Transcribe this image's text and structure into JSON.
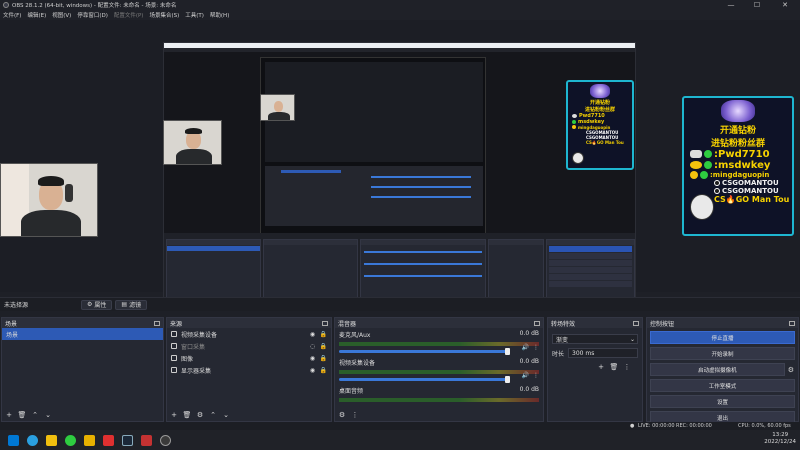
{
  "window": {
    "title": "OBS 28.1.2 (64-bit, windows) - 配置文件: 未命名 - 场景: 未命名",
    "controls": [
      "—",
      "☐",
      "✕"
    ]
  },
  "menu": [
    {
      "label": "文件(F)",
      "disabled": false
    },
    {
      "label": "编辑(E)",
      "disabled": false
    },
    {
      "label": "视图(V)",
      "disabled": false
    },
    {
      "label": "停靠窗口(D)",
      "disabled": false
    },
    {
      "label": "配置文件(P)",
      "disabled": true
    },
    {
      "label": "场景集合(S)",
      "disabled": false
    },
    {
      "label": "工具(T)",
      "disabled": false
    },
    {
      "label": "帮助(H)",
      "disabled": false
    }
  ],
  "promo_large": {
    "line1": "开通钻粉",
    "line2": "进钻粉粉丝群",
    "line3": ":Pwd7710",
    "line4": ":msdwkey",
    "line5": ":mingdaguopin",
    "line6": "CSGOMANTOU",
    "line7": "CSGOMANTOU",
    "line8": "CS🔥GO Man Tou"
  },
  "promo_medium": {
    "line1": "开通钻粉",
    "line2": "进钻粉粉丝群",
    "line3": "Pwd7710",
    "line4": "msdwkey",
    "line5": "mingdaguopin",
    "line6": "CSGOMANTOU",
    "line7": "CSGOMANTOU",
    "line8": "CS🔥GO Man Tou"
  },
  "scene_toolbar": {
    "source_name": "未选择源",
    "properties_label": "属性",
    "filters_label": "滤镜"
  },
  "scenes": {
    "title": "场景",
    "items": [
      {
        "label": "场景",
        "selected": true
      }
    ]
  },
  "sources": {
    "title": "来源",
    "items": [
      {
        "label": "视频采集设备",
        "icon": "camera-icon"
      },
      {
        "label": "窗口采集",
        "icon": "window-icon"
      },
      {
        "label": "图像",
        "icon": "image-icon"
      },
      {
        "label": "显示器采集",
        "icon": "monitor-icon"
      }
    ]
  },
  "mixer": {
    "title": "混音器",
    "tracks": [
      {
        "name": "麦克风/Aux",
        "db": "0.0 dB"
      },
      {
        "name": "视频采集设备",
        "db": "0.0 dB"
      },
      {
        "name": "桌面音频",
        "db": "0.0 dB"
      }
    ]
  },
  "transitions": {
    "title": "转场特效",
    "type": "渐变",
    "duration_label": "时长",
    "duration_value": "300 ms"
  },
  "controls": {
    "title": "控制按钮",
    "buttons": [
      {
        "label": "停止直播",
        "primary": true
      },
      {
        "label": "开始录制",
        "primary": false
      },
      {
        "label": "启动虚拟摄像机",
        "primary": false
      },
      {
        "label": "工作室模式",
        "primary": false
      },
      {
        "label": "设置",
        "primary": false
      },
      {
        "label": "退出",
        "primary": false
      }
    ]
  },
  "status": {
    "live": "LIVE: 00:00:00",
    "rec": "REC: 00:00:00",
    "cpu": "CPU: 0.0%, 60.00 fps"
  },
  "clock": {
    "time": "13:29",
    "date": "2022/12/24"
  },
  "colors": {
    "accent": "#2d5ab5",
    "panel": "#252832",
    "background": "#1e2027",
    "promo_text": "#f7d200",
    "promo_border": "#1eb6d0"
  }
}
